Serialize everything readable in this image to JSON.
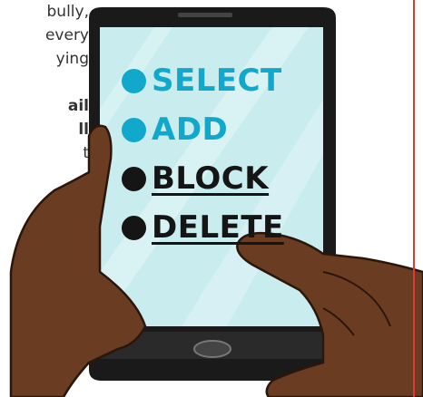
{
  "side_text": {
    "lines": [
      {
        "text": "bully,",
        "bold": false
      },
      {
        "text": "every",
        "bold": false
      },
      {
        "text": "ying",
        "bold": false
      },
      {
        "text": "",
        "bold": false
      },
      {
        "text": "ail",
        "bold": true
      },
      {
        "text": "ll",
        "bold": true
      },
      {
        "text": "t",
        "bold": false
      }
    ]
  },
  "phone_menu": {
    "items": [
      {
        "label": "SELECT",
        "state": "active"
      },
      {
        "label": "ADD",
        "state": "active"
      },
      {
        "label": "BLOCK",
        "state": "dark"
      },
      {
        "label": "DELETE",
        "state": "dark"
      }
    ]
  },
  "colors": {
    "accent": "#12a8cc",
    "dark": "#151515",
    "phone_body": "#1a1a1a",
    "screen": "#c9ecef",
    "skin": "#6a3d22",
    "border": "#e23a3a"
  }
}
